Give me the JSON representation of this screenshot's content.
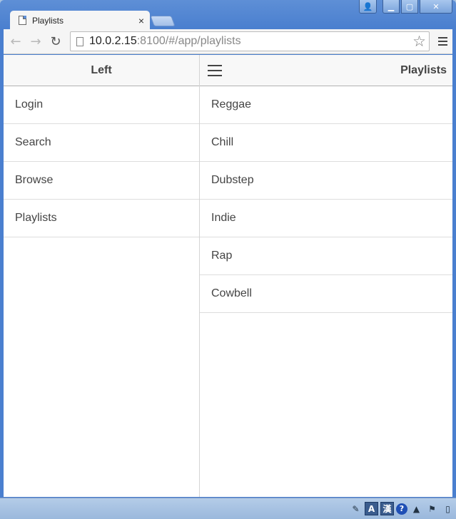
{
  "browser": {
    "tab_title": "Playlists",
    "tab_close": "×",
    "url_host": "10.0.2.15",
    "url_rest": ":8100/#/app/playlists",
    "icons": {
      "back": "←",
      "forward": "→",
      "reload": "↻",
      "bookmark": "☆"
    }
  },
  "window_controls": {
    "user": "👤",
    "minimize": "▁",
    "maximize": "▢",
    "close": "✕"
  },
  "left_menu": {
    "title": "Left",
    "items": [
      {
        "label": "Login"
      },
      {
        "label": "Search"
      },
      {
        "label": "Browse"
      },
      {
        "label": "Playlists"
      }
    ]
  },
  "main": {
    "title": "Playlists",
    "items": [
      {
        "label": "Reggae"
      },
      {
        "label": "Chill"
      },
      {
        "label": "Dubstep"
      },
      {
        "label": "Indie"
      },
      {
        "label": "Rap"
      },
      {
        "label": "Cowbell"
      }
    ]
  },
  "tray": {
    "ime_a": "A",
    "ime_han": "漢",
    "help": "?",
    "arrow": "▲",
    "flag": "⚑",
    "network": "▯",
    "lang": "✎"
  },
  "colors": {
    "header_bg": "#f8f8f8",
    "text": "#444444",
    "divider": "#dddddd",
    "chrome_frame": "#4a7fcf"
  }
}
